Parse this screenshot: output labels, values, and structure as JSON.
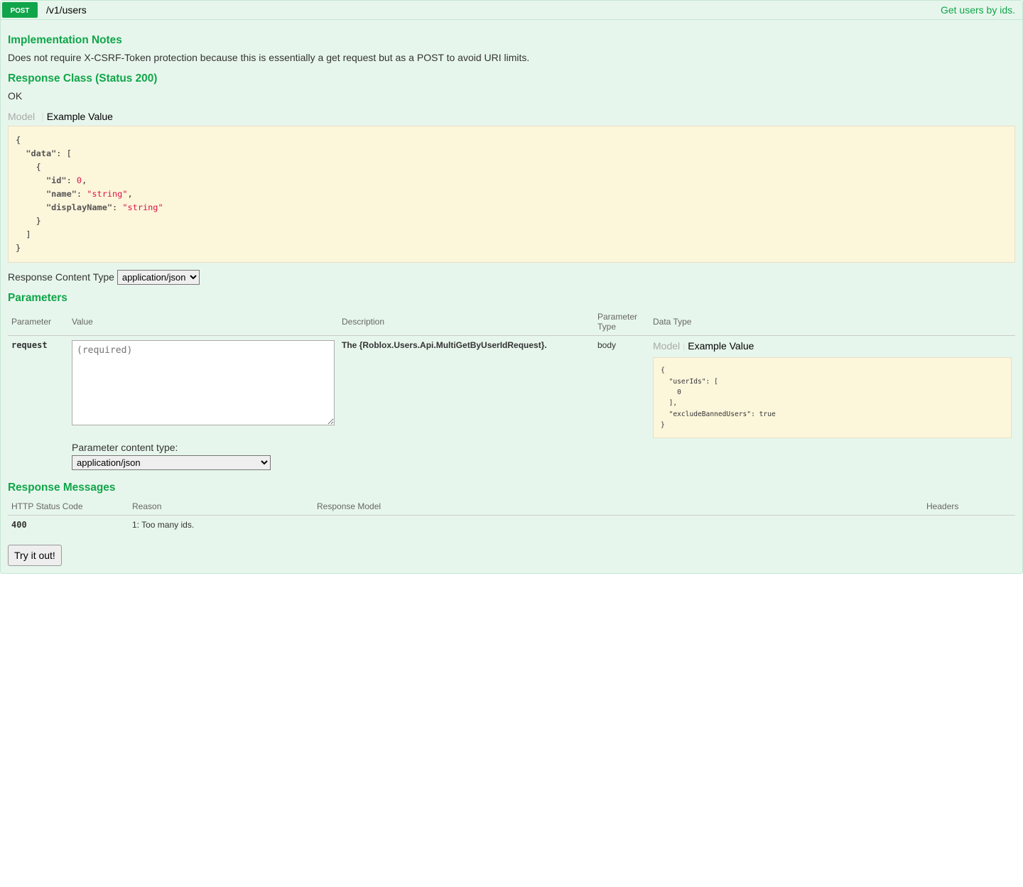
{
  "header": {
    "method": "POST",
    "path": "/v1/users",
    "summary": "Get users by ids."
  },
  "sections": {
    "notes_title": "Implementation Notes",
    "notes_body": "Does not require X-CSRF-Token protection because this is essentially a get request but as a POST to avoid URI limits.",
    "response_class_title": "Response Class (Status 200)",
    "status_text": "OK",
    "parameters_title": "Parameters",
    "response_messages_title": "Response Messages"
  },
  "tabs": {
    "model": "Model",
    "example": "Example Value"
  },
  "response_example_lines": [
    {
      "indent": 0,
      "parts": [
        {
          "t": "punc",
          "v": "{"
        }
      ]
    },
    {
      "indent": 1,
      "parts": [
        {
          "t": "key",
          "v": "\"data\""
        },
        {
          "t": "punc",
          "v": ": ["
        }
      ]
    },
    {
      "indent": 2,
      "parts": [
        {
          "t": "punc",
          "v": "{"
        }
      ]
    },
    {
      "indent": 3,
      "parts": [
        {
          "t": "key",
          "v": "\"id\""
        },
        {
          "t": "punc",
          "v": ": "
        },
        {
          "t": "num",
          "v": "0"
        },
        {
          "t": "punc",
          "v": ","
        }
      ]
    },
    {
      "indent": 3,
      "parts": [
        {
          "t": "key",
          "v": "\"name\""
        },
        {
          "t": "punc",
          "v": ": "
        },
        {
          "t": "str",
          "v": "\"string\""
        },
        {
          "t": "punc",
          "v": ","
        }
      ]
    },
    {
      "indent": 3,
      "parts": [
        {
          "t": "key",
          "v": "\"displayName\""
        },
        {
          "t": "punc",
          "v": ": "
        },
        {
          "t": "str",
          "v": "\"string\""
        }
      ]
    },
    {
      "indent": 2,
      "parts": [
        {
          "t": "punc",
          "v": "}"
        }
      ]
    },
    {
      "indent": 1,
      "parts": [
        {
          "t": "punc",
          "v": "]"
        }
      ]
    },
    {
      "indent": 0,
      "parts": [
        {
          "t": "punc",
          "v": "}"
        }
      ]
    }
  ],
  "response_content_type": {
    "label": "Response Content Type ",
    "options": [
      "application/json"
    ],
    "selected": "application/json"
  },
  "param_table": {
    "headers": {
      "parameter": "Parameter",
      "value": "Value",
      "description": "Description",
      "ptype": "Parameter Type",
      "dtype": "Data Type"
    },
    "row": {
      "name": "request",
      "placeholder": "(required)",
      "description_prefix": "The ",
      "description_bold": "{Roblox.Users.Api.MultiGetByUserIdRequest}.",
      "ptype": "body",
      "ctype_label": "Parameter content type:",
      "ctype_options": [
        "application/json"
      ],
      "ctype_selected": "application/json"
    }
  },
  "request_example_lines": [
    {
      "indent": 0,
      "parts": [
        {
          "t": "punc",
          "v": "{"
        }
      ]
    },
    {
      "indent": 1,
      "parts": [
        {
          "t": "key",
          "v": "\"userIds\""
        },
        {
          "t": "punc",
          "v": ": ["
        }
      ]
    },
    {
      "indent": 2,
      "parts": [
        {
          "t": "num",
          "v": "0"
        }
      ]
    },
    {
      "indent": 1,
      "parts": [
        {
          "t": "punc",
          "v": "],"
        }
      ]
    },
    {
      "indent": 1,
      "parts": [
        {
          "t": "key",
          "v": "\"excludeBannedUsers\""
        },
        {
          "t": "punc",
          "v": ": "
        },
        {
          "t": "bool",
          "v": "true"
        }
      ]
    },
    {
      "indent": 0,
      "parts": [
        {
          "t": "punc",
          "v": "}"
        }
      ]
    }
  ],
  "resp_table": {
    "headers": {
      "code": "HTTP Status Code",
      "reason": "Reason",
      "model": "Response Model",
      "headers": "Headers"
    },
    "rows": [
      {
        "code": "400",
        "reason": "1: Too many ids."
      }
    ]
  },
  "try_button": "Try it out!"
}
